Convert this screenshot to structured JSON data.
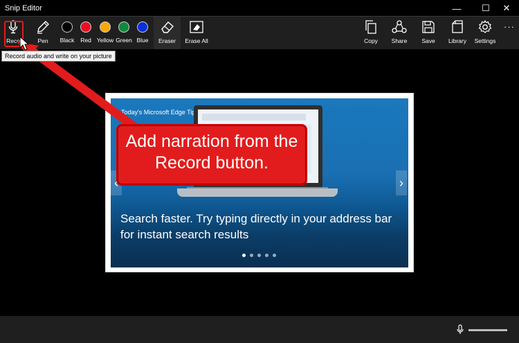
{
  "window": {
    "title": "Snip Editor",
    "minimize": "—",
    "maximize": "☐",
    "close": "✕"
  },
  "toolbar": {
    "record": "Reco",
    "pen": "Pen",
    "colors": [
      {
        "label": "Black",
        "color": "#000000"
      },
      {
        "label": "Red",
        "color": "#e81123"
      },
      {
        "label": "Yellow",
        "color": "#f7a808"
      },
      {
        "label": "Green",
        "color": "#10893e"
      },
      {
        "label": "Blue",
        "color": "#0b2fd8"
      }
    ],
    "eraser": "Eraser",
    "erase_all": "Erase All",
    "copy": "Copy",
    "share": "Share",
    "save": "Save",
    "library": "Library",
    "settings": "Settings",
    "more": "···"
  },
  "tooltip": "Record audio and write on your picture",
  "image": {
    "tip": "Today's Microsoft Edge Tip",
    "headline": "Search faster. Try typing directly in your address bar for instant search results"
  },
  "callout": {
    "text": "Add narration from the Record button."
  },
  "accent": "#e21c1c"
}
